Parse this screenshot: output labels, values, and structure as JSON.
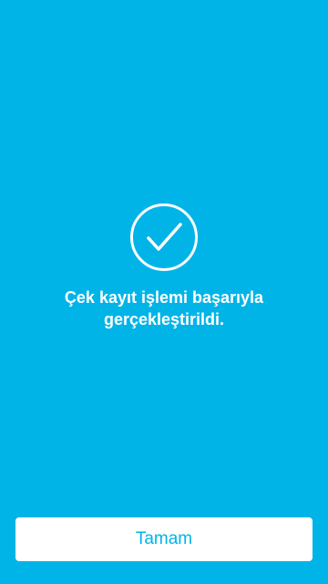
{
  "theme": {
    "background": "#00b4e8",
    "foreground": "#ffffff",
    "button_background": "#ffffff",
    "button_text": "#00b4e8"
  },
  "status": {
    "icon": "check-circle-icon",
    "message": "Çek kayıt işlemi başarıyla gerçekleştirildi."
  },
  "actions": {
    "ok_label": "Tamam"
  }
}
